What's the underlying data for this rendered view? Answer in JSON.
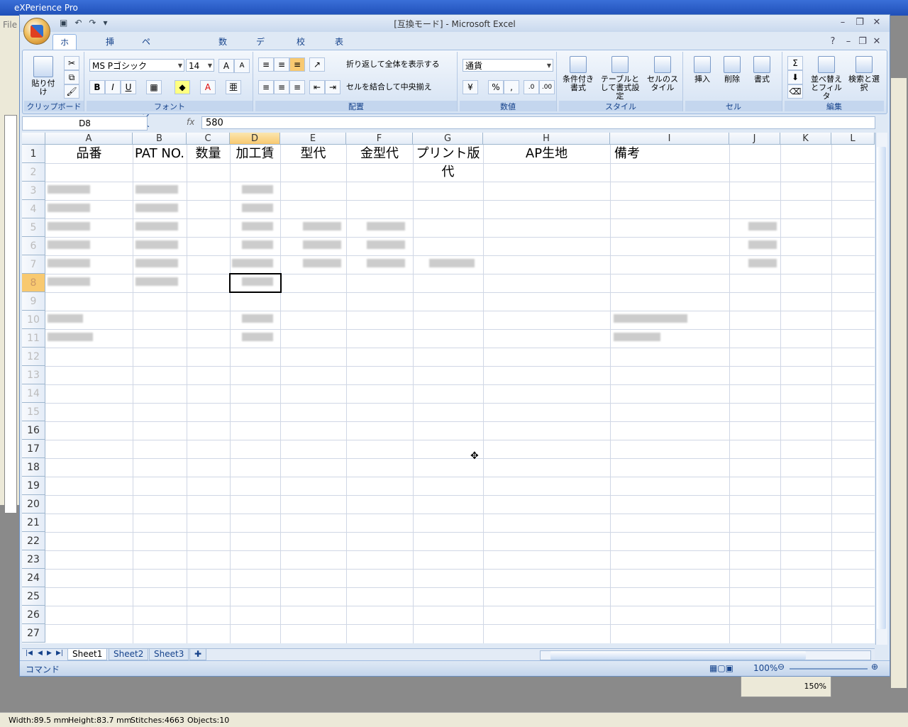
{
  "background_app": {
    "title": "eXPerience Pro",
    "menu_file": "File",
    "status": {
      "width": "Width:89.5 mm",
      "height": "Height:83.7 mm",
      "stitches": "Stitches:4663",
      "objects": "Objects:10"
    },
    "zoom_box": "150%"
  },
  "excel": {
    "title": "[互換モード] - Microsoft Excel",
    "tabs": [
      "ホーム",
      "挿入",
      "ページ レイアウト",
      "数式",
      "データ",
      "校閲",
      "表示"
    ],
    "ribbon": {
      "clipboard": {
        "paste": "貼り付け",
        "label": "クリップボード"
      },
      "font": {
        "name": "MS Pゴシック",
        "size": "14",
        "label": "フォント",
        "bold": "B",
        "italic": "I",
        "underline": "U"
      },
      "alignment": {
        "wrap": "折り返して全体を表示する",
        "merge": "セルを結合して中央揃え",
        "label": "配置"
      },
      "number": {
        "format": "通貨",
        "label": "数値"
      },
      "styles": {
        "conditional": "条件付き書式",
        "table": "テーブルとして書式設定",
        "cell": "セルのスタイル",
        "label": "スタイル"
      },
      "cells": {
        "insert": "挿入",
        "delete": "削除",
        "format": "書式",
        "label": "セル"
      },
      "editing": {
        "sort": "並べ替えとフィルタ",
        "find": "検索と選択",
        "label": "編集"
      }
    },
    "namebox": "D8",
    "formula": "580",
    "fx": "fx",
    "columns": [
      "A",
      "B",
      "C",
      "D",
      "E",
      "F",
      "G",
      "H",
      "I",
      "J",
      "K",
      "L"
    ],
    "rows": [
      "1",
      "2",
      "3",
      "4",
      "5",
      "6",
      "7",
      "8",
      "9",
      "10",
      "11",
      "12",
      "13",
      "14",
      "15",
      "16",
      "17",
      "18",
      "19",
      "20",
      "21",
      "22",
      "23",
      "24",
      "25",
      "26",
      "27"
    ],
    "headers": [
      "品番",
      "PAT NO.",
      "数量",
      "加工賃",
      "型代",
      "金型代",
      "プリント版代",
      "AP生地",
      "備考"
    ],
    "sheets": [
      "Sheet1",
      "Sheet2",
      "Sheet3"
    ],
    "status_mode": "コマンド",
    "zoom": "100%"
  }
}
